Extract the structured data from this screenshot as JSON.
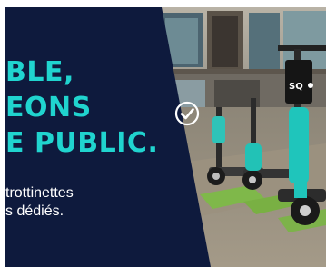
{
  "banner": {
    "headline_lines": [
      "BLE,",
      "EONS",
      "E PUBLIC."
    ],
    "subtext_lines": [
      "trottinettes",
      "s dédiés."
    ],
    "scooter_brand": "SQ",
    "check_icon": "check-circle-icon",
    "colors": {
      "navy": "#0e1a3d",
      "accent": "#20d4cf",
      "text": "#ffffff"
    }
  }
}
